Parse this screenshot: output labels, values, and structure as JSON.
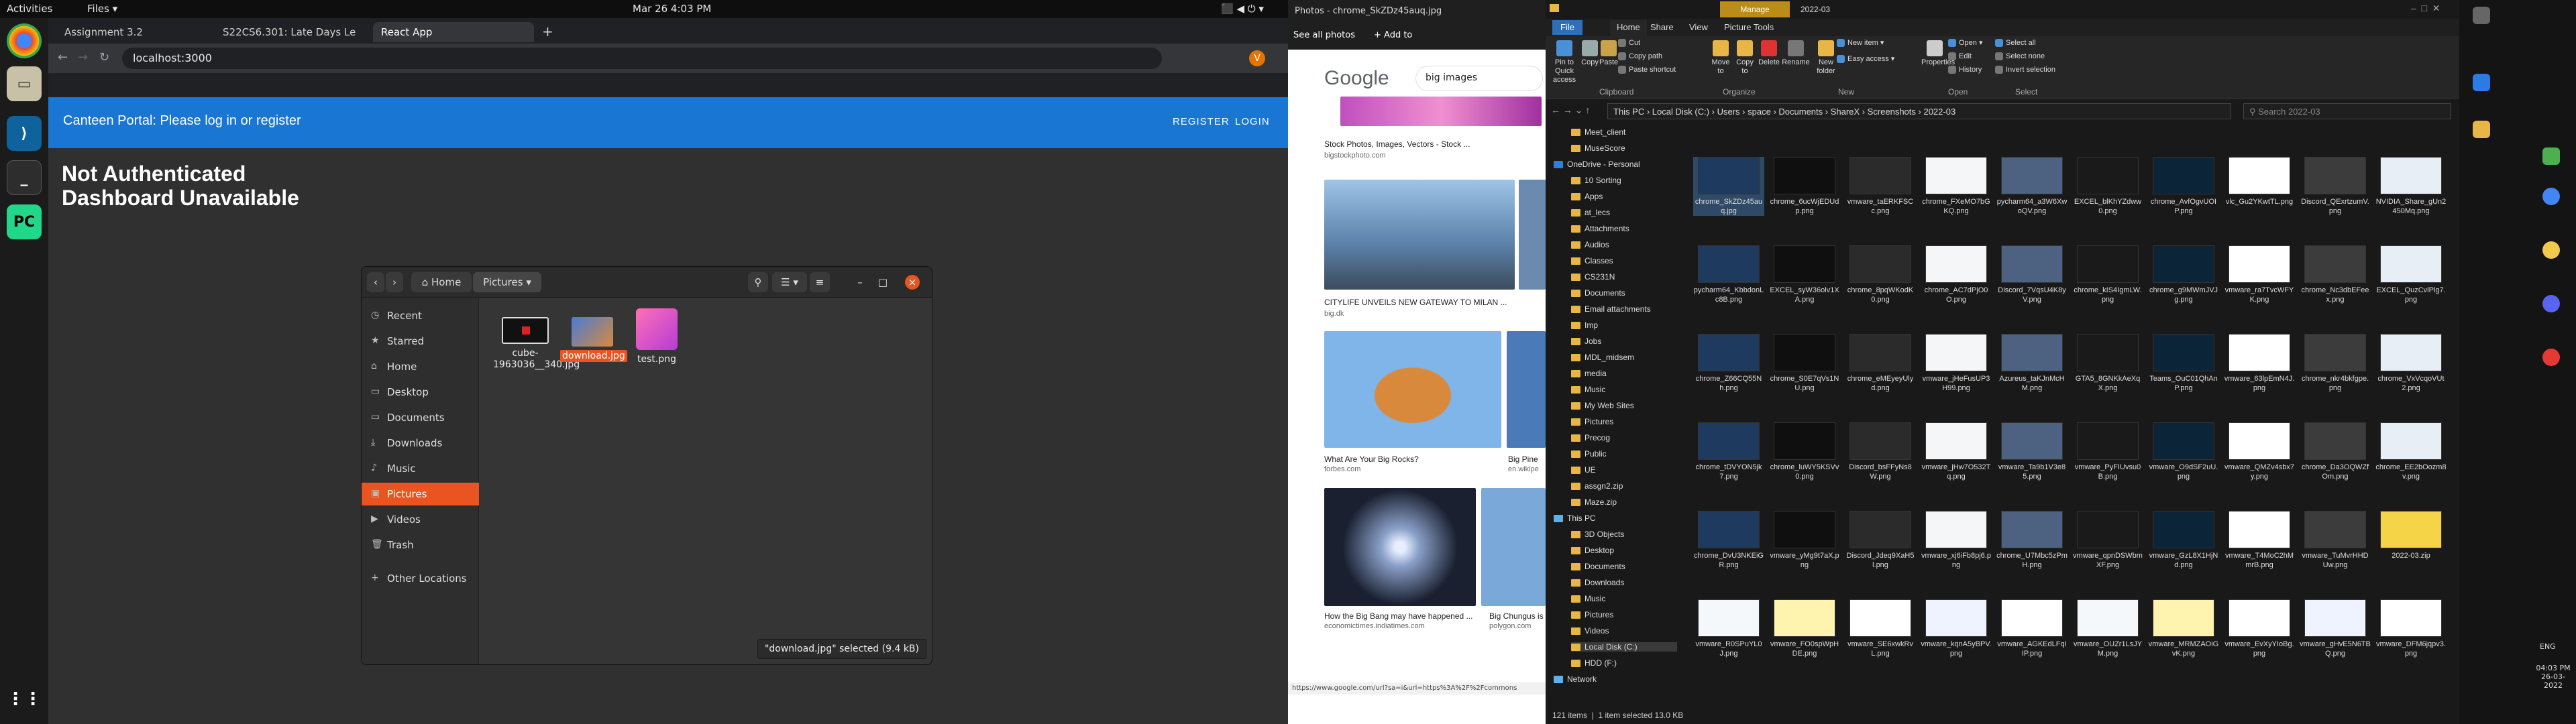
{
  "ubuntu": {
    "activities": "Activities",
    "files_menu": "Files ▾",
    "clock": "Mar 26  4:03 PM",
    "tray": "⬛ ◀ ⏻ ▾"
  },
  "chrome": {
    "tabs": [
      {
        "label": "Assignment 3.2",
        "active": false
      },
      {
        "label": "S22CS6.301: Late Days Le",
        "active": false
      },
      {
        "label": "React App",
        "active": true
      }
    ],
    "new_tab": "+",
    "url": "localhost:3000",
    "nav": {
      "back": "←",
      "forward": "→",
      "reload": "↻"
    },
    "profile_initial": "V"
  },
  "app": {
    "title": "Canteen Portal: Please log in or register",
    "register": "REGISTER",
    "login": "LOGIN",
    "heading1": "Not Authenticated",
    "heading2": "Dashboard Unavailable"
  },
  "nautilus": {
    "breadcrumb_home": "Home",
    "breadcrumb_current": "Pictures",
    "sidebar": [
      {
        "label": "Recent",
        "icon": "clock-icon",
        "glyph": "◷"
      },
      {
        "label": "Starred",
        "icon": "star-icon",
        "glyph": "★"
      },
      {
        "label": "Home",
        "icon": "home-icon",
        "glyph": "⌂"
      },
      {
        "label": "Desktop",
        "icon": "folder-icon",
        "glyph": "▭"
      },
      {
        "label": "Documents",
        "icon": "folder-icon",
        "glyph": "▭"
      },
      {
        "label": "Downloads",
        "icon": "download-icon",
        "glyph": "⤓"
      },
      {
        "label": "Music",
        "icon": "music-icon",
        "glyph": "♪"
      },
      {
        "label": "Pictures",
        "icon": "image-icon",
        "glyph": "▣",
        "active": true
      },
      {
        "label": "Videos",
        "icon": "video-icon",
        "glyph": "▶"
      },
      {
        "label": "Trash",
        "icon": "trash-icon",
        "glyph": "🗑"
      },
      {
        "label": "Other Locations",
        "icon": "plus-icon",
        "glyph": "+"
      }
    ],
    "files": [
      {
        "name": "cube-1963036__340.jpg",
        "selected": false
      },
      {
        "name": "download.jpg",
        "selected": true
      },
      {
        "name": "test.png",
        "selected": false
      }
    ],
    "status": "\"download.jpg\" selected  (9.4 kB)"
  },
  "photos": {
    "title": "Photos - chrome_SkZDz45auq.jpg",
    "see_all": "See all photos",
    "add_to": "+ Add to",
    "google_query": "big images",
    "results": [
      {
        "caption": "Stock Photos, Images, Vectors - Stock ...",
        "source": "bigstockphoto.com"
      },
      {
        "caption": "CITYLIFE UNVEILS NEW GATEWAY TO MILAN ...",
        "source": "big.dk"
      },
      {
        "caption": "What Are Your Big Rocks?",
        "source": "forbes.com"
      },
      {
        "caption": "How the Big Bang may have happened ...",
        "source": "economictimes.indiatimes.com"
      },
      {
        "caption": "Big Pine",
        "source": "en.wikipe"
      },
      {
        "caption": "Big Chungus is",
        "source": "polygon.com"
      }
    ],
    "footer_url": "https://www.google.com/url?sa=i&url=https%3A%2F%2Fcommons"
  },
  "explorer": {
    "manage_tab": "Manage",
    "folder_title": "2022-03",
    "tabs": [
      "File",
      "Home",
      "Share",
      "View",
      "Picture Tools"
    ],
    "ribbon_buttons": [
      "Pin to Quick access",
      "Copy",
      "Paste",
      "Cut",
      "Copy path",
      "Paste shortcut",
      "Move to",
      "Copy to",
      "Delete",
      "Rename",
      "New folder",
      "New item ▾",
      "Easy access ▾",
      "Properties",
      "Open ▾",
      "Edit",
      "History",
      "Select all",
      "Select none",
      "Invert selection"
    ],
    "ribbon_groups": [
      "Clipboard",
      "Organize",
      "New",
      "Open",
      "Select"
    ],
    "path": [
      "This PC",
      "Local Disk (C:)",
      "Users",
      "space",
      "Documents",
      "ShareX",
      "Screenshots",
      "2022-03"
    ],
    "search_placeholder": "Search 2022-03",
    "nav": [
      "Meet_client",
      "MuseScore",
      "OneDrive - Personal",
      "10 Sorting",
      "Apps",
      "at_lecs",
      "Attachments",
      "Audios",
      "Classes",
      "CS231N",
      "Documents",
      "Email attachments",
      "Imp",
      "Jobs",
      "MDL_midsem",
      "media",
      "Music",
      "My Web Sites",
      "Pictures",
      "Precog",
      "Public",
      "UE",
      "assgn2.zip",
      "Maze.zip",
      "This PC",
      "3D Objects",
      "Desktop",
      "Documents",
      "Downloads",
      "Music",
      "Pictures",
      "Videos",
      "Local Disk (C:)",
      "HDD (F:)",
      "Network"
    ],
    "files": [
      "chrome_SkZDz45auq.jpg",
      "chrome_6ucWjEDUdp.png",
      "vmware_taERKFSCc.png",
      "chrome_FXeMO7bGKQ.png",
      "pycharm64_a3W6XwoQV.png",
      "EXCEL_blKhYZdww0.png",
      "chrome_AvfOgvUOIP.png",
      "vlc_Gu2YKwtTL.png",
      "Discord_QExrtzumV.png",
      "NVIDIA_Share_gUn2450Mq.png",
      "pycharm64_KbbdonLc8B.png",
      "EXCEL_syW36olv1XA.png",
      "chrome_8pqWKodK0.png",
      "chrome_AC7dPjO0O.png",
      "Discord_7VqsU4K8yV.png",
      "chrome_kIS4IgmLW.png",
      "chrome_g9MWmJVJg.png",
      "vmware_ra7TvcWFYK.png",
      "chrome_Nc3dbEFeex.png",
      "EXCEL_QuzCvlPlg7.png",
      "chrome_Z66CQ55Nh.png",
      "chrome_S0E7qVs1NU.png",
      "chrome_eMEyeyUlyd.png",
      "vmware_jHeFusUP3H99.png",
      "Azureus_taKJnMcHM.png",
      "GTA5_8GNKkAeXqX.png",
      "Teams_OuC01QhAnP.png",
      "vmware_63lpEmN4J.png",
      "chrome_nkr4bkfgpe.png",
      "chrome_VxVcqoVUt2.png",
      "chrome_tDVYON5jk7.png",
      "chrome_luWY5KSVv0.png",
      "Discord_bsFFyNs8W.png",
      "vmware_jHw7O532Tq.png",
      "vmware_Ta9b1V3e85.png",
      "vmware_PyFIUvsu0B.png",
      "vmware_O9dSF2uU.png",
      "vmware_QMZv4sbx7y.png",
      "chrome_Da3OQWZfOm.png",
      "chrome_EE2bOozm8v.png",
      "chrome_DvU3NKEiGR.png",
      "vmware_yMg9t7aX.png",
      "Discord_Jdeq9XaH5l.png",
      "vmware_xj6iFb8pj6.png",
      "chrome_U7Mbc5zPmH.png",
      "vmware_qpnDSWbmXF.png",
      "vmware_GzL8X1HjNd.png",
      "vmware_T4MoC2hMmrB.png",
      "vmware_TuMvrHHDUw.png",
      "2022-03.zip",
      "vmware_R0SPuYL0J.png",
      "vmware_FO0spWpHDE.png",
      "vmware_SE6xwkRvL.png",
      "vmware_kqnA5yBPV.png",
      "vmware_AGKEdLFqIIP.png",
      "vmware_OUZr1LsJYM.png",
      "vmware_MRMZAOiGvK.png",
      "vmware_EvXyYIoBg.png",
      "vmware_gHvE5N6TBQ.png",
      "vmware_DFM6jqpv3.png"
    ],
    "status_count": "121 items",
    "status_selected": "1 item selected  13.0 KB"
  },
  "taskbar": {
    "time": "04:03 PM",
    "date": "26-03-2022",
    "lang": "ENG"
  }
}
